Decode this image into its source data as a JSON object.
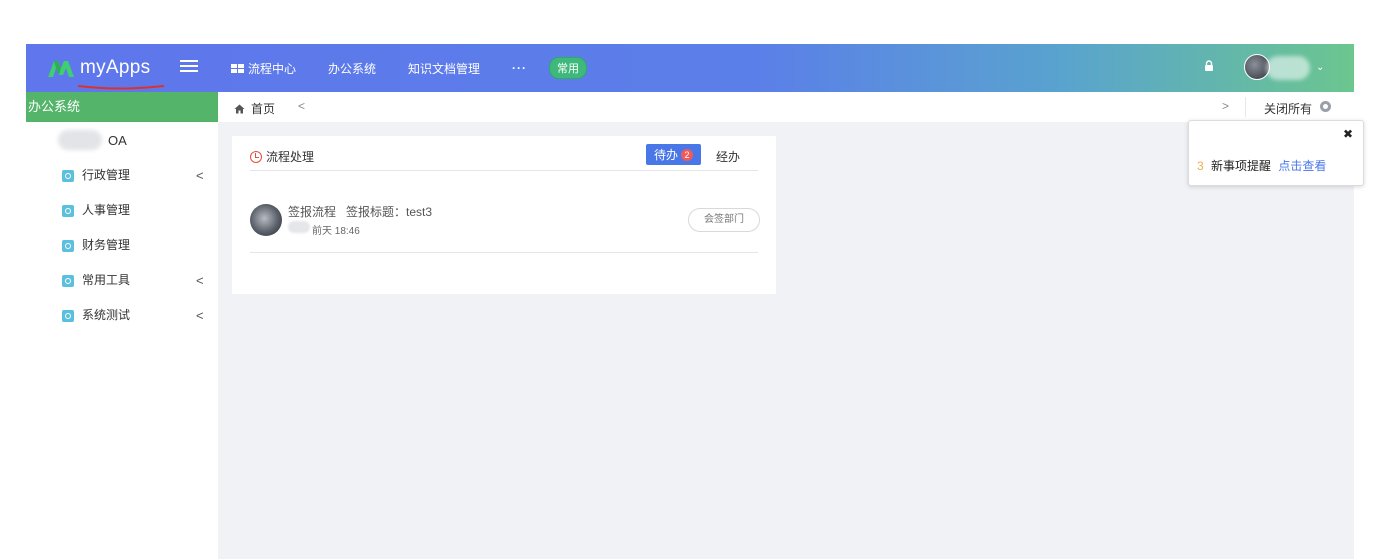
{
  "header": {
    "app_name": "myApps",
    "nav": [
      {
        "label": "流程中心"
      },
      {
        "label": "办公系统"
      },
      {
        "label": "知识文档管理"
      }
    ],
    "more_label": "···",
    "pill_label": "常用",
    "caret": "⌄"
  },
  "sidebar": {
    "title": "办公系统",
    "oa_label": "OA",
    "items": [
      {
        "label": "行政管理",
        "chevron": "<"
      },
      {
        "label": "人事管理",
        "chevron": ""
      },
      {
        "label": "财务管理",
        "chevron": ""
      },
      {
        "label": "常用工具",
        "chevron": "<"
      },
      {
        "label": "系统测试",
        "chevron": "<"
      }
    ]
  },
  "tabs": {
    "home_label": "首页",
    "prev": "<",
    "next": ">",
    "close_all": "关闭所有"
  },
  "card": {
    "title": "流程处理",
    "tab_todo": "待办",
    "todo_count": "2",
    "tab_done": "经办",
    "rows": [
      {
        "title": "签报流程   签报标题：test3",
        "time": "前天 18:46",
        "action": "会签部门"
      }
    ]
  },
  "notice": {
    "close": "✖",
    "count": "3",
    "message": "新事项提醒",
    "link": "点击查看"
  },
  "colors": {
    "topbar_start": "#5f76ec",
    "topbar_end": "#6bc68f",
    "sidebar_header": "#53b46a",
    "primary": "#4a77e8",
    "badge": "#f05a5a"
  }
}
